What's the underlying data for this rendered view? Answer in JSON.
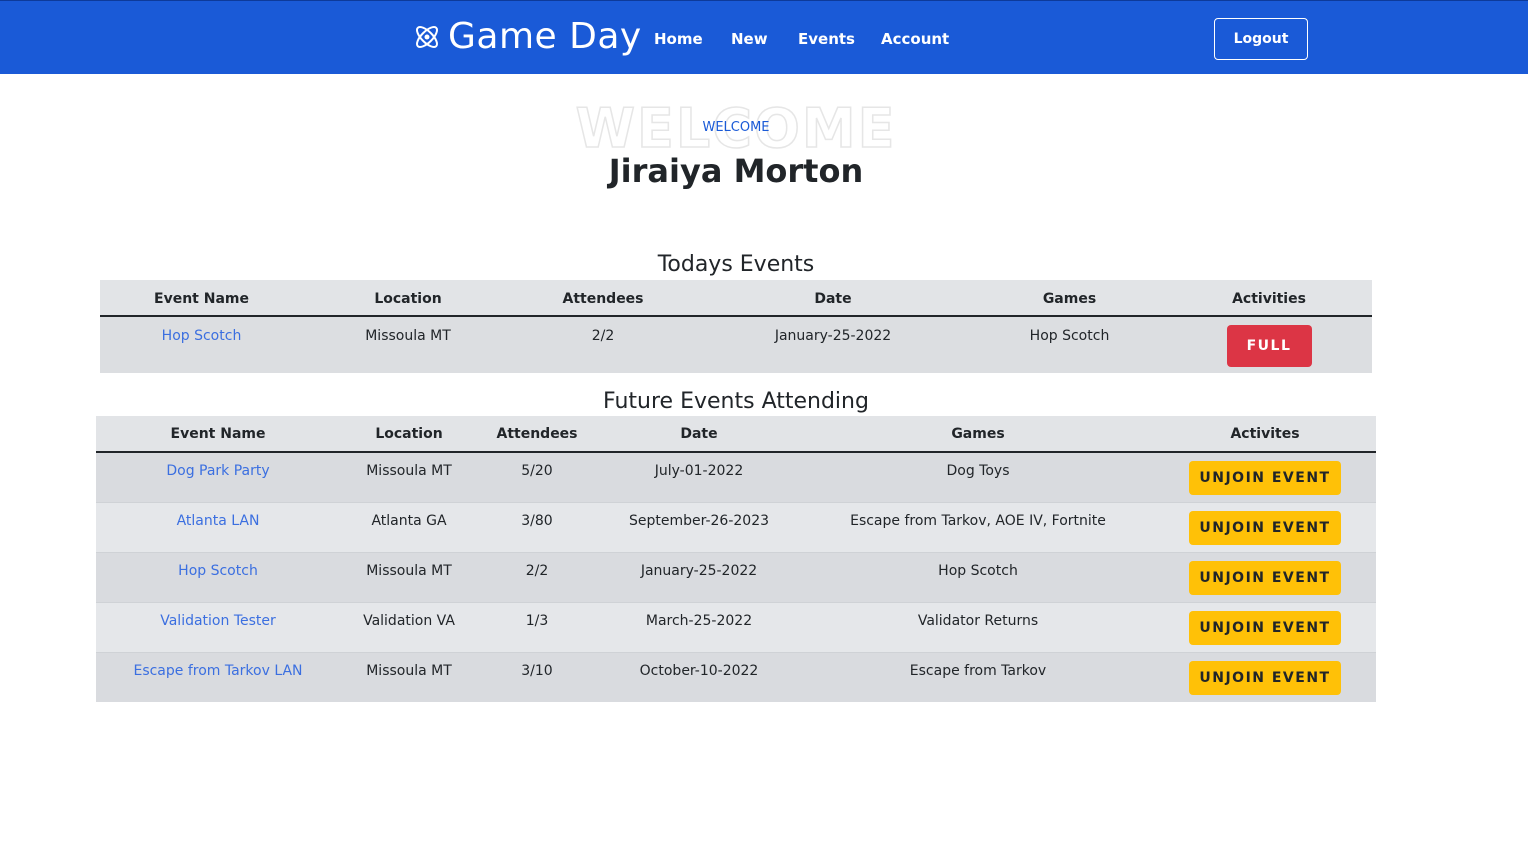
{
  "nav": {
    "brand": "Game Day",
    "links": [
      "Home",
      "New",
      "Events",
      "Account"
    ],
    "logout": "Logout"
  },
  "welcome": {
    "bg_text": "WELCOME",
    "label": "WELCOME",
    "user_name": "Jiraiya Morton"
  },
  "today": {
    "title": "Todays Events",
    "headers": [
      "Event Name",
      "Location",
      "Attendees",
      "Date",
      "Games",
      "Activities"
    ],
    "rows": [
      {
        "name": "Hop Scotch",
        "location": "Missoula MT",
        "attendees": "2/2",
        "date": "January-25-2022",
        "games": "Hop Scotch",
        "action": "FULL"
      }
    ]
  },
  "future": {
    "title": "Future Events Attending",
    "headers": [
      "Event Name",
      "Location",
      "Attendees",
      "Date",
      "Games",
      "Activites"
    ],
    "rows": [
      {
        "name": "Dog Park Party",
        "location": "Missoula MT",
        "attendees": "5/20",
        "date": "July-01-2022",
        "games": "Dog Toys",
        "action": "UNJOIN EVENT"
      },
      {
        "name": "Atlanta LAN",
        "location": "Atlanta GA",
        "attendees": "3/80",
        "date": "September-26-2023",
        "games": "Escape from Tarkov, AOE IV, Fortnite",
        "action": "UNJOIN EVENT"
      },
      {
        "name": "Hop Scotch",
        "location": "Missoula MT",
        "attendees": "2/2",
        "date": "January-25-2022",
        "games": "Hop Scotch",
        "action": "UNJOIN EVENT"
      },
      {
        "name": "Validation Tester",
        "location": "Validation VA",
        "attendees": "1/3",
        "date": "March-25-2022",
        "games": "Validator Returns",
        "action": "UNJOIN EVENT"
      },
      {
        "name": "Escape from Tarkov LAN",
        "location": "Missoula MT",
        "attendees": "3/10",
        "date": "October-10-2022",
        "games": "Escape from Tarkov",
        "action": "UNJOIN EVENT"
      }
    ]
  },
  "colors": {
    "navbar": "#1a5ad7",
    "link": "#3b6fe0",
    "full_button": "#dc3545",
    "unjoin_button": "#ffc107"
  },
  "icons": {
    "brand": "atom-icon"
  }
}
